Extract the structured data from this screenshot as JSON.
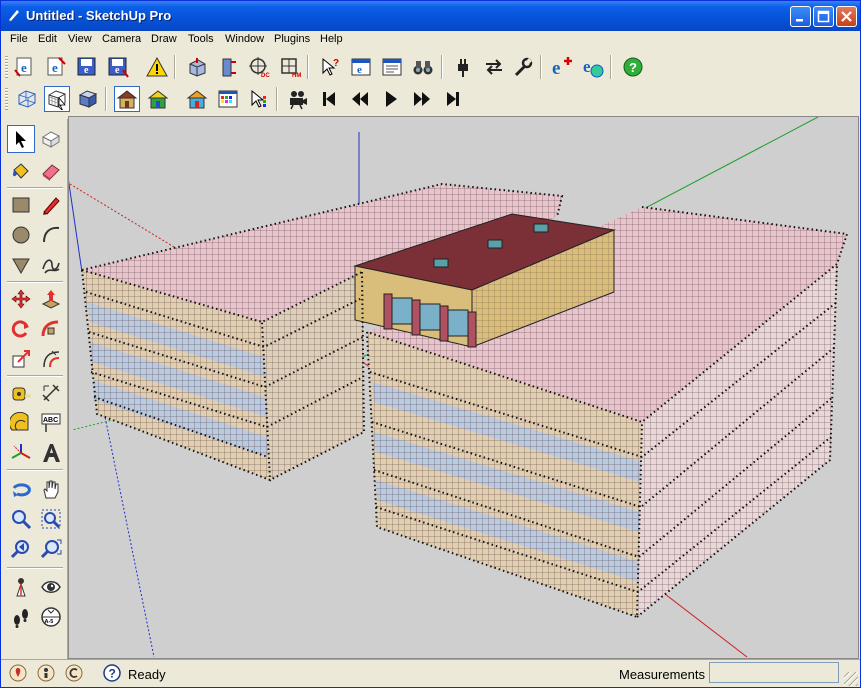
{
  "window": {
    "title": "Untitled - SketchUp Pro",
    "controls": [
      "minimize",
      "maximize",
      "close"
    ]
  },
  "menubar": {
    "items": [
      "File",
      "Edit",
      "View",
      "Camera",
      "Draw",
      "Tools",
      "Window",
      "Plugins",
      "Help"
    ]
  },
  "toolbar_top": {
    "icons": [
      "ie-export-icon",
      "ie-import-icon",
      "ie-save-icon",
      "ie-save-as-icon",
      "warning-icon",
      "model-info-icon",
      "model-stats-icon",
      "zone-dc-icon",
      "zone-hm-icon",
      "help-pointer-icon",
      "ie-window-icon",
      "dialog-icon",
      "binoculars-icon",
      "plug-icon",
      "swap-arrows-icon",
      "wrench-icon",
      "ie-add-icon",
      "ie-globe-icon",
      "green-help-icon"
    ]
  },
  "toolbar_second": {
    "icons": [
      "xray-cube-icon",
      "hidden-line-cube-icon",
      "shaded-cube-icon",
      "house-icon",
      "house-color-icon",
      "house-texture-icon",
      "palette-icon",
      "color-pointer-icon",
      "movie-camera-icon",
      "first-frame-icon",
      "previous-frame-icon",
      "play-icon",
      "next-frame-icon",
      "last-frame-icon"
    ]
  },
  "left_toolbar": {
    "icons": [
      "select-arrow-icon",
      "eraser-box-icon",
      "paint-bucket-icon",
      "eraser-icon",
      "rectangle-icon",
      "pencil-icon",
      "circle-icon",
      "arc-icon",
      "polygon-icon",
      "freehand-icon",
      "move-icon",
      "push-pull-icon",
      "rotate-icon",
      "follow-me-icon",
      "scale-icon",
      "offset-icon",
      "tape-measure-icon",
      "dimension-icon",
      "protractor-icon",
      "text-label-icon",
      "axes-icon",
      "3d-text-icon",
      "orbit-icon",
      "pan-hand-icon",
      "zoom-icon",
      "zoom-window-icon",
      "previous-view-icon",
      "zoom-extents-icon",
      "position-camera-icon",
      "look-around-icon",
      "walk-footprints-icon",
      "section-plane-icon"
    ],
    "text_label_glyph": "ABC",
    "section_glyph": "A-5"
  },
  "statusbar": {
    "status_text": "Ready",
    "measurements_label": "Measurements",
    "measurements_value": ""
  },
  "colors": {
    "title_blue": "#0653d8",
    "viewport_bg": "#cfcfcf",
    "roof_red": "#7a3036",
    "wall_tan": "#d9bd7a",
    "grid_pink": "#e8c4cc",
    "glass_blue": "#b8cbe0",
    "axis_green": "#1ea02a",
    "axis_red": "#cc2020",
    "axis_blue": "#2030cc"
  }
}
